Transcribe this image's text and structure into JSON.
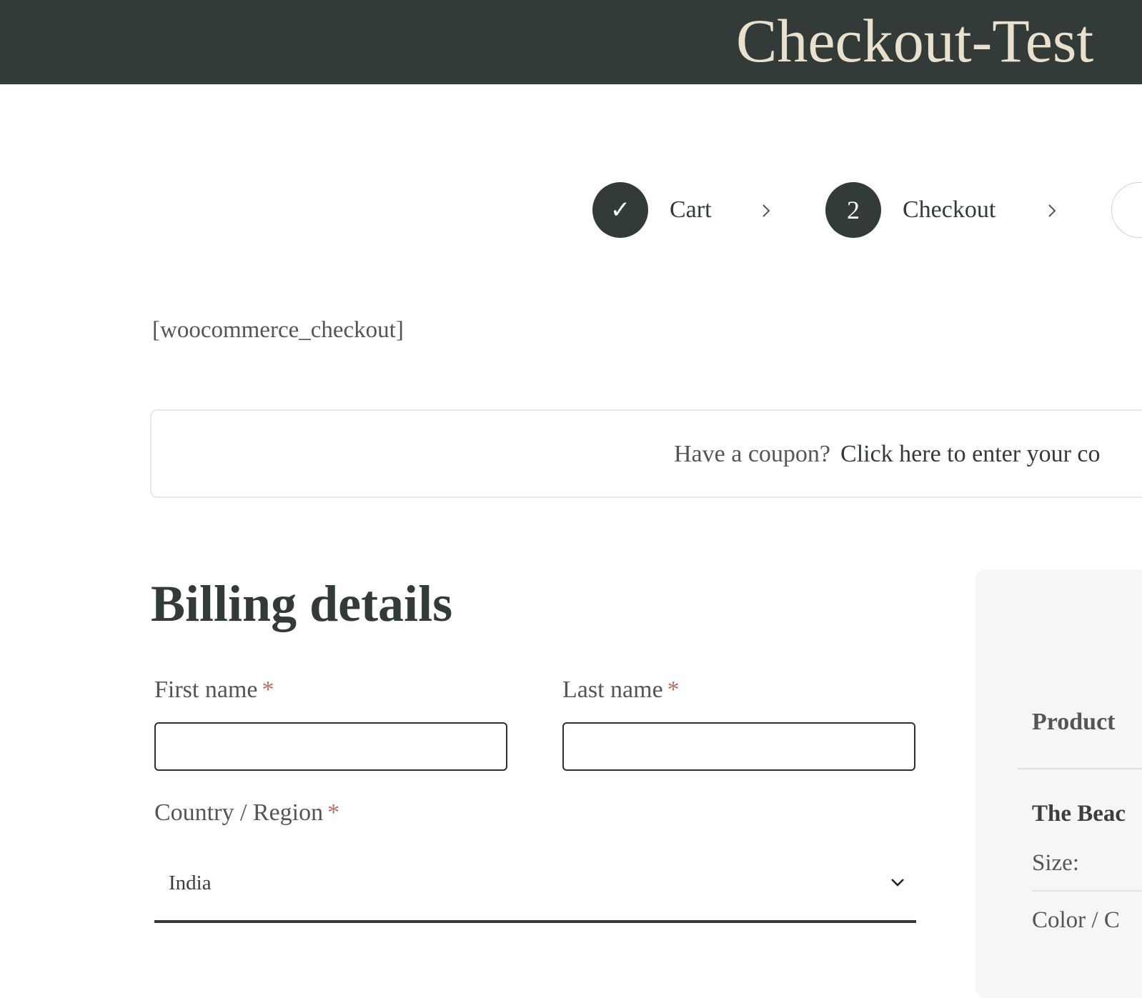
{
  "header": {
    "site_title": "Checkout-Test"
  },
  "steps": [
    {
      "label": "Cart",
      "marker": "✓",
      "state": "completed"
    },
    {
      "label": "Checkout",
      "marker": "2",
      "state": "current"
    }
  ],
  "shortcode": "[woocommerce_checkout]",
  "coupon": {
    "prompt": "Have a coupon?",
    "link": "Click here to enter your co"
  },
  "billing": {
    "title": "Billing details",
    "first_name_label": "First name",
    "last_name_label": "Last name",
    "country_label": "Country / Region",
    "required_marker": "*",
    "country_value": "India",
    "first_name_value": "",
    "last_name_value": ""
  },
  "order": {
    "column_header": "Product",
    "product_name": "The Beac",
    "meta_size_label": "Size:",
    "meta_color_label": "Color / C"
  },
  "colors": {
    "header_bg": "#333b38",
    "title_color": "#e9e1cd",
    "required_color": "#b87068",
    "panel_bg": "#f6f6f6"
  },
  "icons": {
    "cart_step": "check-icon",
    "step_separator": "chevron-right-icon",
    "select_toggle": "chevron-down-icon"
  }
}
